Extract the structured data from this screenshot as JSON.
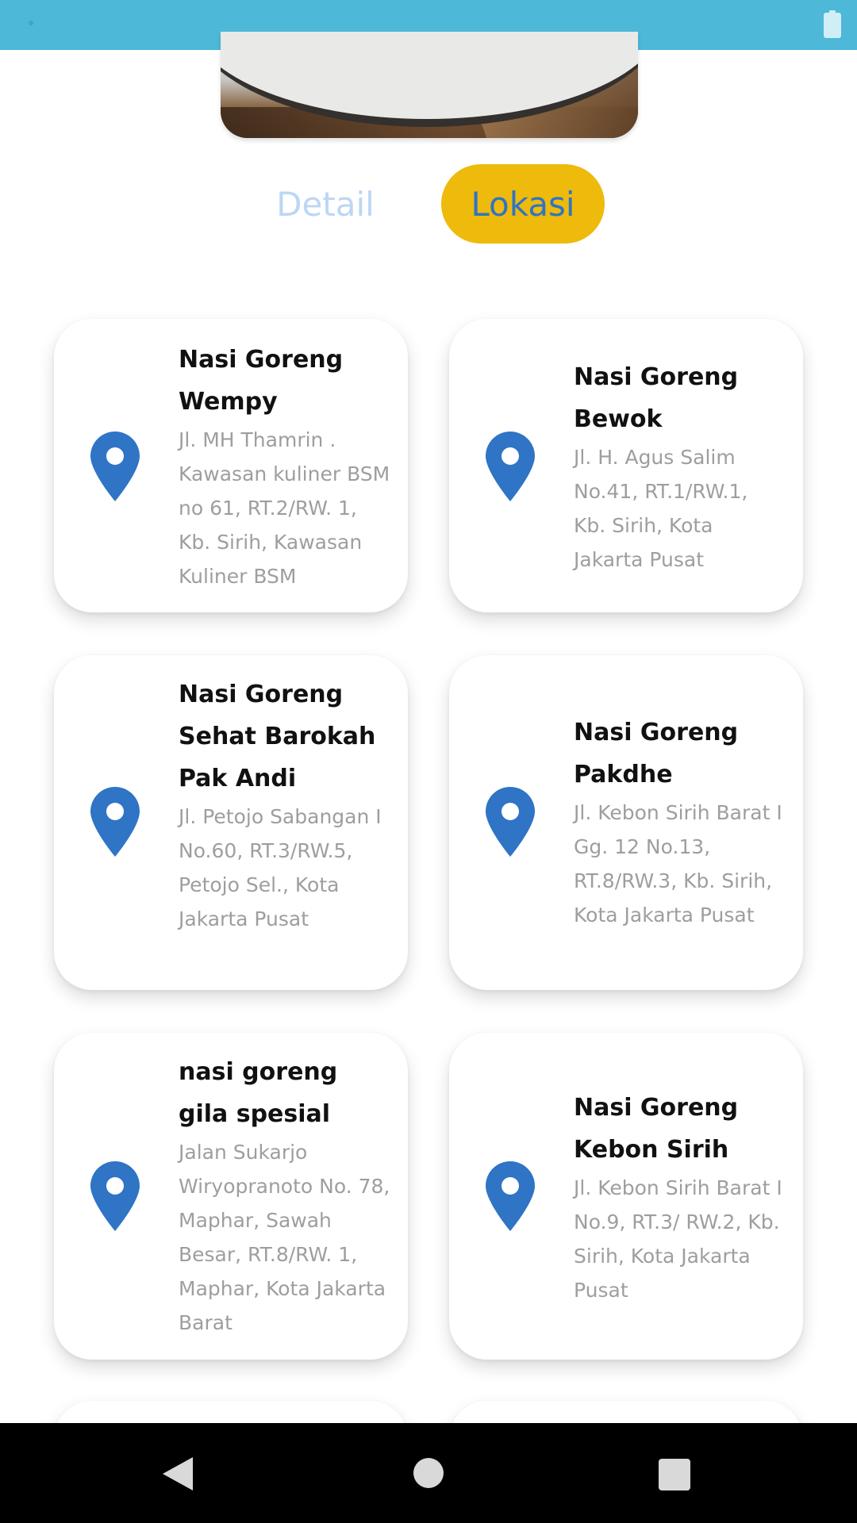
{
  "tabs": {
    "detail_label": "Detail",
    "lokasi_label": "Lokasi",
    "active": "Lokasi"
  },
  "icons": {
    "pin": "location-pin-icon",
    "back": "back-triangle-icon",
    "home": "home-circle-icon",
    "recents": "recents-square-icon",
    "battery": "battery-icon"
  },
  "colors": {
    "status_bar": "#4db8d8",
    "active_tab_bg": "#eeba0b",
    "active_tab_text": "#2f74c5",
    "inactive_tab_text": "#bcd6f5",
    "pin": "#2f74c5",
    "name_text": "#111111",
    "address_text": "#9e9e9e"
  },
  "locations": [
    {
      "name": "Nasi Goreng Wempy",
      "address": "Jl. MH Thamrin . Kawasan kuliner BSM no 61, RT.2/RW. 1, Kb. Sirih, Kawasan Kuliner BSM"
    },
    {
      "name": "Nasi Goreng Bewok",
      "address": "Jl. H. Agus Salim No.41, RT.1/RW.1, Kb. Sirih, Kota Jakarta Pusat"
    },
    {
      "name": "Nasi Goreng Sehat Barokah Pak Andi",
      "address": "Jl. Petojo Sabangan I No.60, RT.3/RW.5, Petojo Sel., Kota Jakarta Pusat"
    },
    {
      "name": "Nasi Goreng Pakdhe",
      "address": "Jl. Kebon Sirih Barat I Gg. 12 No.13, RT.8/RW.3, Kb. Sirih, Kota Jakarta Pusat"
    },
    {
      "name": "nasi goreng gila spesial",
      "address": "Jalan Sukarjo Wiryopranoto No. 78, Maphar, Sawah Besar, RT.8/RW. 1, Maphar, Kota Jakarta Barat"
    },
    {
      "name": "Nasi Goreng Kebon Sirih",
      "address": "Jl. Kebon Sirih Barat I No.9, RT.3/ RW.2, Kb. Sirih, Kota Jakarta Pusat"
    }
  ]
}
